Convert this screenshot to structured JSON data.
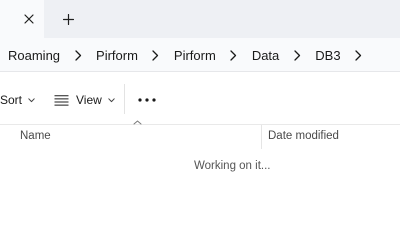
{
  "tab": {
    "close_icon": "close-icon",
    "new_tab_icon": "plus-icon"
  },
  "breadcrumb": {
    "items": [
      "Roaming",
      "Pirform",
      "Pirform",
      "Data",
      "DB3"
    ],
    "separator_icon": "chevron-right-icon"
  },
  "toolbar": {
    "sort_label": "Sort",
    "view_label": "View",
    "more_icon": "more-horizontal-icon"
  },
  "columns": {
    "name": "Name",
    "date_modified": "Date modified"
  },
  "status": {
    "text": "Working on it..."
  },
  "colors": {
    "tabstrip_bg": "#eef0f4",
    "address_bg": "#f9fafc",
    "content_bg": "#ffffff"
  }
}
